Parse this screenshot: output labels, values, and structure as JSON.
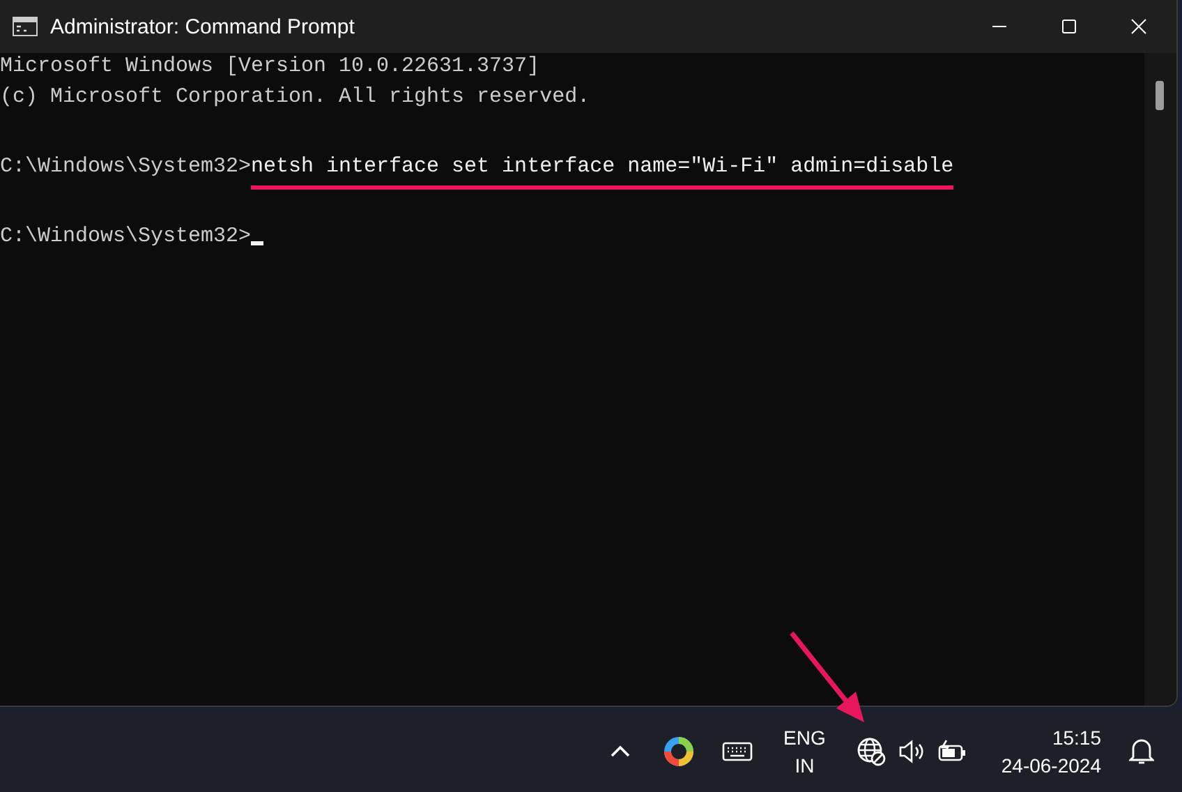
{
  "window": {
    "title": "Administrator: Command Prompt"
  },
  "console": {
    "lines": [
      {
        "kind": "output",
        "text": "Microsoft Windows [Version 10.0.22631.3737]"
      },
      {
        "kind": "output",
        "text": "(c) Microsoft Corporation. All rights reserved."
      },
      {
        "kind": "blank"
      },
      {
        "kind": "command",
        "prompt": "C:\\Windows\\System32>",
        "text": "netsh interface set interface name=\"Wi-Fi\" admin=disable",
        "underlined": true
      },
      {
        "kind": "blank"
      },
      {
        "kind": "command",
        "prompt": "C:\\Windows\\System32>",
        "cursor": true
      }
    ]
  },
  "taskbar": {
    "language": [
      "ENG",
      "IN"
    ],
    "time": "15:15",
    "date": "24-06-2024",
    "pointer_on_network": true
  }
}
